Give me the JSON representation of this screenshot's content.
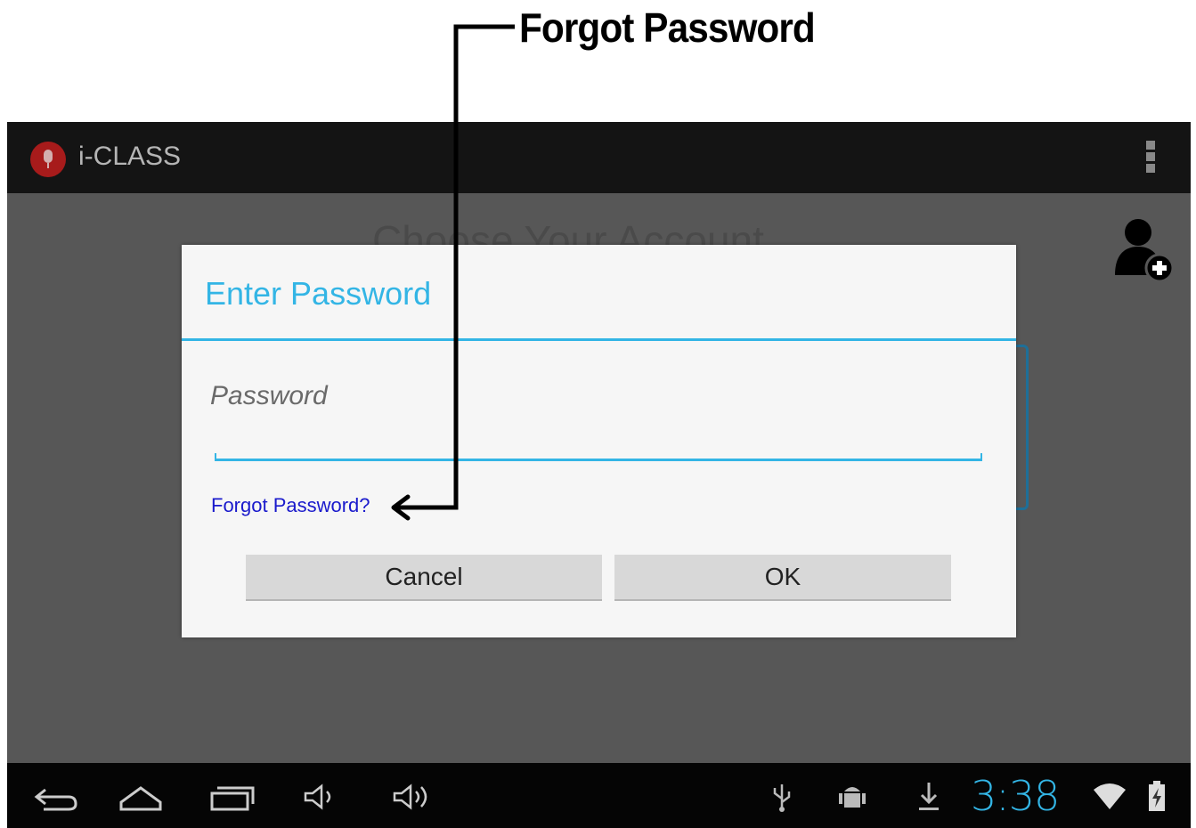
{
  "annotation": {
    "label": "Forgot Password"
  },
  "app": {
    "title": "i-CLASS"
  },
  "background": {
    "heading": "Choose Your Account"
  },
  "dialog": {
    "title": "Enter Password",
    "password_placeholder": "Password",
    "forgot_link": "Forgot Password?",
    "cancel_label": "Cancel",
    "ok_label": "OK"
  },
  "status": {
    "time": "3:38"
  },
  "colors": {
    "accent": "#33b5e5",
    "link": "#1a1acc"
  }
}
